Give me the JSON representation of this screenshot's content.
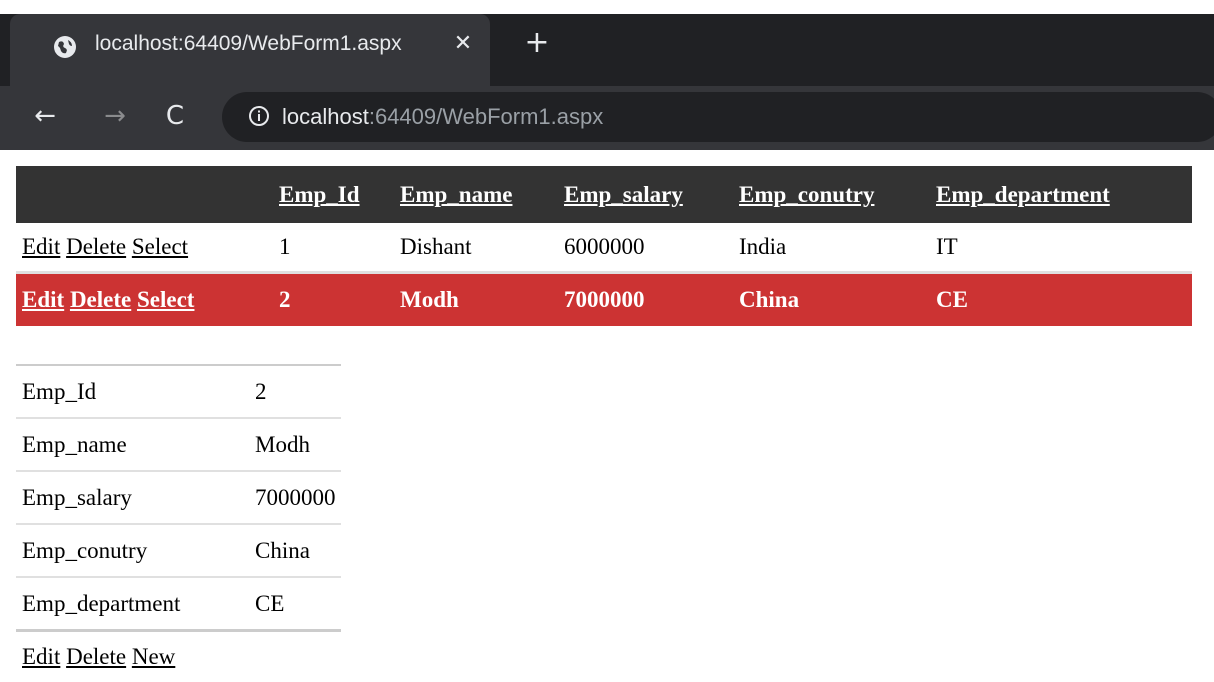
{
  "browser": {
    "tab_title": "localhost:64409/WebForm1.aspx",
    "url_host": "localhost",
    "url_rest": ":64409/WebForm1.aspx",
    "theme_colors": {
      "tabstrip": "#202124",
      "toolbar": "#35363a",
      "text": "#e8eaed",
      "dim": "#9aa0a6"
    }
  },
  "gridview": {
    "headers": [
      "Emp_Id",
      "Emp_name",
      "Emp_salary",
      "Emp_conutry",
      "Emp_department"
    ],
    "commands": {
      "edit": "Edit",
      "delete": "Delete",
      "select": "Select"
    },
    "rows": [
      {
        "id": "1",
        "name": "Dishant",
        "salary": "6000000",
        "country": "India",
        "department": "IT",
        "selected": false
      },
      {
        "id": "2",
        "name": "Modh",
        "salary": "7000000",
        "country": "China",
        "department": "CE",
        "selected": true
      }
    ],
    "colors": {
      "header_bg": "#333333",
      "selected_bg": "#cc3333"
    }
  },
  "detailsview": {
    "fields": [
      {
        "label": "Emp_Id",
        "value": "2"
      },
      {
        "label": "Emp_name",
        "value": "Modh"
      },
      {
        "label": "Emp_salary",
        "value": "7000000"
      },
      {
        "label": "Emp_conutry",
        "value": "China"
      },
      {
        "label": "Emp_department",
        "value": "CE"
      }
    ],
    "commands": {
      "edit": "Edit",
      "delete": "Delete",
      "new": "New"
    }
  }
}
